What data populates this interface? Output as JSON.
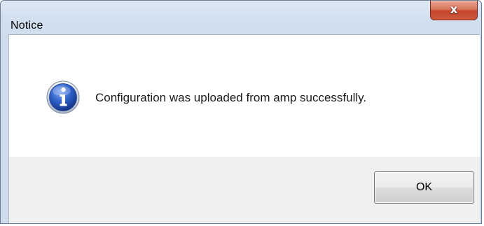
{
  "window": {
    "title": "Notice",
    "close_icon": "close-x-icon",
    "close_glyph": "x"
  },
  "message": {
    "icon": "info-icon",
    "text": "Configuration was uploaded from amp successfully."
  },
  "buttons": {
    "ok_label": "OK"
  },
  "colors": {
    "close_button": "#c4432b",
    "info_icon": "#1e4fb0",
    "button_area": "#f0f0f0"
  }
}
